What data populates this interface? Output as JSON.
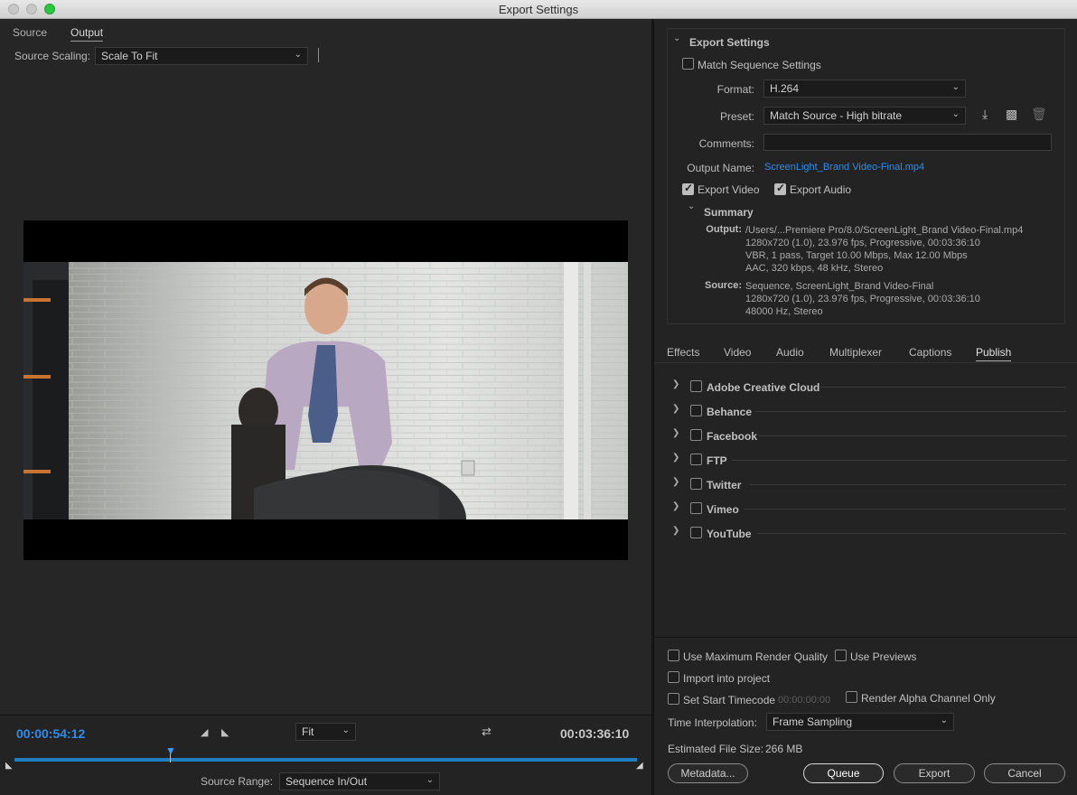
{
  "window": {
    "title": "Export Settings"
  },
  "source_panel": {
    "tabs": [
      "Source",
      "Output"
    ],
    "active_tab": "Output",
    "source_scaling_label": "Source Scaling:",
    "source_scaling_value": "Scale To Fit"
  },
  "transport": {
    "current_timecode": "00:00:54:12",
    "duration_timecode": "00:03:36:10",
    "zoom_value": "Fit",
    "source_range_label": "Source Range:",
    "source_range_value": "Sequence In/Out",
    "timecode_color": "#2d8ceb",
    "timeline_color": "#1f7fc0"
  },
  "export_settings": {
    "section_title": "Export Settings",
    "match_sequence_label": "Match Sequence Settings",
    "match_sequence_checked": false,
    "format_label": "Format:",
    "format_value": "H.264",
    "preset_label": "Preset:",
    "preset_value": "Match Source - High bitrate",
    "comments_label": "Comments:",
    "comments_value": "",
    "output_name_label": "Output Name:",
    "output_name_value": "ScreenLight_Brand Video-Final.mp4",
    "export_video_label": "Export Video",
    "export_video_checked": true,
    "export_audio_label": "Export Audio",
    "export_audio_checked": true,
    "summary_title": "Summary",
    "output_key": "Output:",
    "output_lines": [
      "/Users/...Premiere Pro/8.0/ScreenLight_Brand Video-Final.mp4",
      "1280x720 (1.0), 23.976 fps, Progressive, 00:03:36:10",
      "VBR, 1 pass, Target 10.00 Mbps, Max 12.00 Mbps",
      "AAC, 320 kbps, 48 kHz, Stereo"
    ],
    "source_key": "Source:",
    "source_lines": [
      "Sequence, ScreenLight_Brand Video-Final",
      "1280x720 (1.0), 23.976 fps, Progressive, 00:03:36:10",
      "48000 Hz, Stereo"
    ]
  },
  "settings_tabs": {
    "items": [
      "Effects",
      "Video",
      "Audio",
      "Multiplexer",
      "Captions",
      "Publish"
    ],
    "active": "Publish"
  },
  "publish_targets": [
    "Adobe Creative Cloud",
    "Behance",
    "Facebook",
    "FTP",
    "Twitter",
    "Vimeo",
    "YouTube"
  ],
  "bottom": {
    "max_render_quality_label": "Use Maximum Render Quality",
    "use_previews_label": "Use Previews",
    "import_into_project_label": "Import into project",
    "set_start_timecode_label": "Set Start Timecode",
    "start_timecode_placeholder": "00:00:00:00",
    "render_alpha_label": "Render Alpha Channel Only",
    "time_interpolation_label": "Time Interpolation:",
    "time_interpolation_value": "Frame Sampling",
    "estimated_size_label": "Estimated File Size:",
    "estimated_size_value": "266 MB",
    "metadata_button": "Metadata...",
    "queue_button": "Queue",
    "export_button": "Export",
    "cancel_button": "Cancel"
  }
}
